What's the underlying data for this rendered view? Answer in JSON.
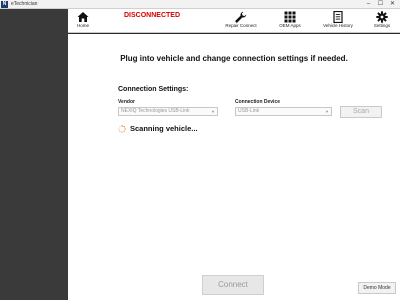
{
  "window": {
    "logo_letter": "N",
    "title": "eTechnician",
    "controls": {
      "minimize": "–",
      "maximize": "☐",
      "close": "✕"
    }
  },
  "toolbar": {
    "status": "DISCONNECTED",
    "items": [
      {
        "label": "Home",
        "icon": "home-icon"
      },
      {
        "label": "Repair Connect",
        "icon": "wrench-icon"
      },
      {
        "label": "OEM Apps",
        "icon": "grid-icon"
      },
      {
        "label": "Vehicle History",
        "icon": "document-icon"
      },
      {
        "label": "Settings",
        "icon": "gear-icon"
      }
    ]
  },
  "main": {
    "headline": "Plug into vehicle and change connection settings if needed.",
    "section_title": "Connection Settings:",
    "vendor": {
      "label": "Vendor",
      "value": "NEXIQ Technologies USB-Link"
    },
    "device": {
      "label": "Connection Device",
      "value": "USB-Link"
    },
    "scan_button": "Scan",
    "scan_status": "Scanning vehicle...",
    "connect_button": "Connect",
    "demo_button": "Demo Mode"
  },
  "colors": {
    "status_red": "#d40000",
    "sidebar": "#3a3a3a",
    "spinner": "#e8731a"
  }
}
